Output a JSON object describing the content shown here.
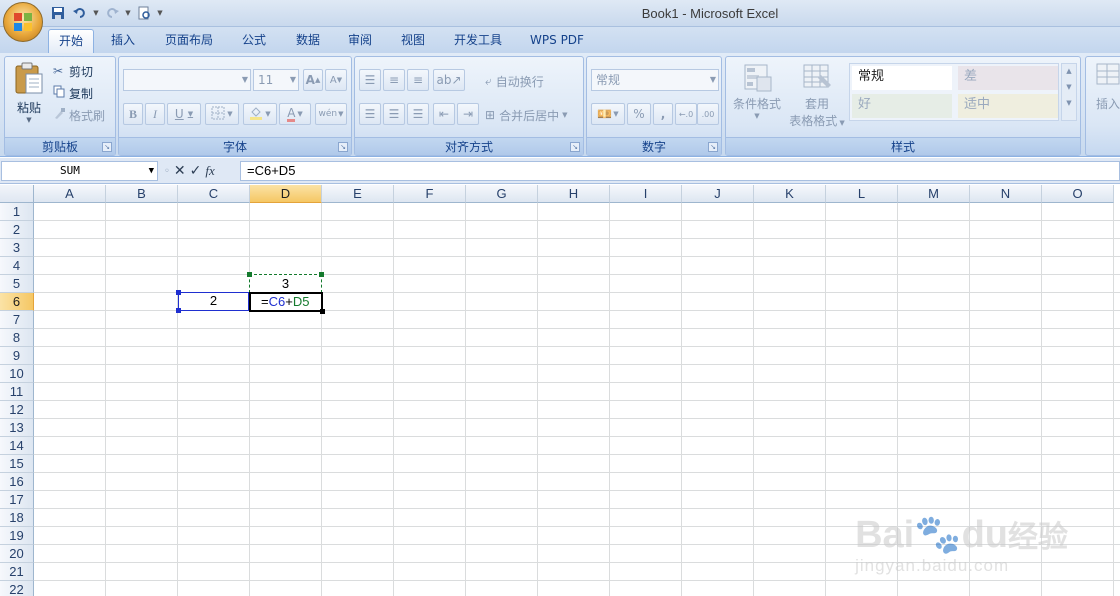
{
  "window": {
    "title": "Book1 - Microsoft Excel"
  },
  "tabs": [
    "开始",
    "插入",
    "页面布局",
    "公式",
    "数据",
    "审阅",
    "视图",
    "开发工具",
    "WPS PDF"
  ],
  "active_tab": "开始",
  "ribbon": {
    "clipboard": {
      "label": "剪贴板",
      "paste": "粘贴",
      "cut": "剪切",
      "copy": "复制",
      "format_painter": "格式刷"
    },
    "font": {
      "label": "字体",
      "font_name": "",
      "font_size": "11",
      "bold": "B",
      "italic": "I",
      "underline": "U"
    },
    "alignment": {
      "label": "对齐方式",
      "wrap_text": "自动换行",
      "merge_center": "合并后居中"
    },
    "number": {
      "label": "数字",
      "format": "常规",
      "percent": "%",
      "comma": ",",
      "inc_decimal": ".00→.0",
      "dec_decimal": ".00"
    },
    "styles": {
      "label": "样式",
      "conditional_format": "条件格式",
      "table_format_1": "套用",
      "table_format_2": "表格格式",
      "cells": [
        "常规",
        "差",
        "好",
        "适中"
      ]
    },
    "cells": {
      "insert": "插入"
    }
  },
  "formula_bar": {
    "name_box": "SUM",
    "fx": "fx",
    "formula": "=C6+D5"
  },
  "columns": [
    "A",
    "B",
    "C",
    "D",
    "E",
    "F",
    "G",
    "H",
    "I",
    "J",
    "K",
    "L",
    "M",
    "N",
    "O"
  ],
  "selected_column": "D",
  "rows": [
    "1",
    "2",
    "3",
    "4",
    "5",
    "6",
    "7",
    "8",
    "9",
    "10",
    "11",
    "12",
    "13",
    "14",
    "15",
    "16",
    "17",
    "18",
    "19",
    "20",
    "21",
    "22"
  ],
  "selected_row": "6",
  "cells": {
    "C6": "2",
    "D5": "3",
    "D6": {
      "prefix": "=",
      "ref1": "C6",
      "op": "+",
      "ref2": "D5"
    }
  },
  "colors": {
    "ref1": "#1f2fd0",
    "ref2": "#147a2d",
    "selection_header": "#f5c764"
  },
  "watermark": {
    "brand": "Bai",
    "brand2": "du",
    "suffix": "经验",
    "url": "jingyan.baidu.com"
  }
}
